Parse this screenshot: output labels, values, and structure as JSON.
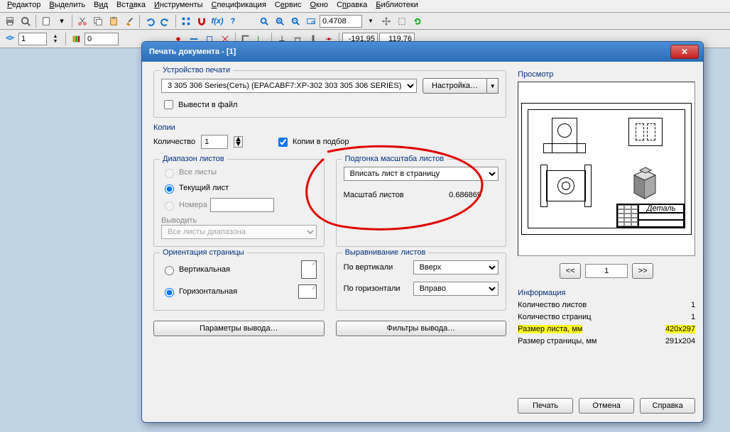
{
  "menu": {
    "items": [
      "Редактор",
      "Выделить",
      "Вид",
      "Вставка",
      "Инструменты",
      "Спецификация",
      "Сервис",
      "Окно",
      "Справка",
      "Библиотеки"
    ]
  },
  "toolbar": {
    "zoom_value": "0.4708",
    "coord_x": "-191.95",
    "coord_y": "119.76",
    "layer_num": "1",
    "small_num": "0"
  },
  "dialog": {
    "title": "Печать документа - [1]",
    "device": {
      "label": "Устройство печати",
      "printer": "3 305 306 Series(Сеть) (EPACABF7:XP-302 303 305 306 SERIES)",
      "config_btn": "Настройка…",
      "output_to_file": "Вывести в файл"
    },
    "copies": {
      "label": "Копии",
      "qty_label": "Количество",
      "qty_value": "1",
      "collate": "Копии в подбор"
    },
    "range": {
      "label": "Диапазон листов",
      "all": "Все листы",
      "current": "Текущий лист",
      "numbers": "Номера",
      "output_label": "Выводить",
      "output_dropdown": "Все листы диапазона"
    },
    "fit": {
      "label": "Подгонка масштаба листов",
      "dropdown": "Вписать лист в страницу",
      "scale_label": "Масштаб листов",
      "scale_value": "0.686869"
    },
    "orient": {
      "label": "Ориентация страницы",
      "vertical": "Вертикальная",
      "horizontal": "Горизонтальная"
    },
    "align": {
      "label": "Выравнивание листов",
      "v_label": "По вертикали",
      "v_value": "Вверх",
      "h_label": "По горизонтали",
      "h_value": "Вправо"
    },
    "params_btn": "Параметры вывода…",
    "filters_btn": "Фильтры вывода…",
    "preview": {
      "label": "Просмотр",
      "page": "1",
      "prev": "<<",
      "next": ">>",
      "detail_label": "Деталь"
    },
    "info": {
      "label": "Информация",
      "sheet_count_label": "Количество листов",
      "sheet_count": "1",
      "page_count_label": "Количество страниц",
      "page_count": "1",
      "sheet_size_label": "Размер листа, мм",
      "sheet_size": "420x297",
      "page_size_label": "Размер страницы, мм",
      "page_size": "291x204"
    },
    "buttons": {
      "print": "Печать",
      "cancel": "Отмена",
      "help": "Справка"
    }
  }
}
